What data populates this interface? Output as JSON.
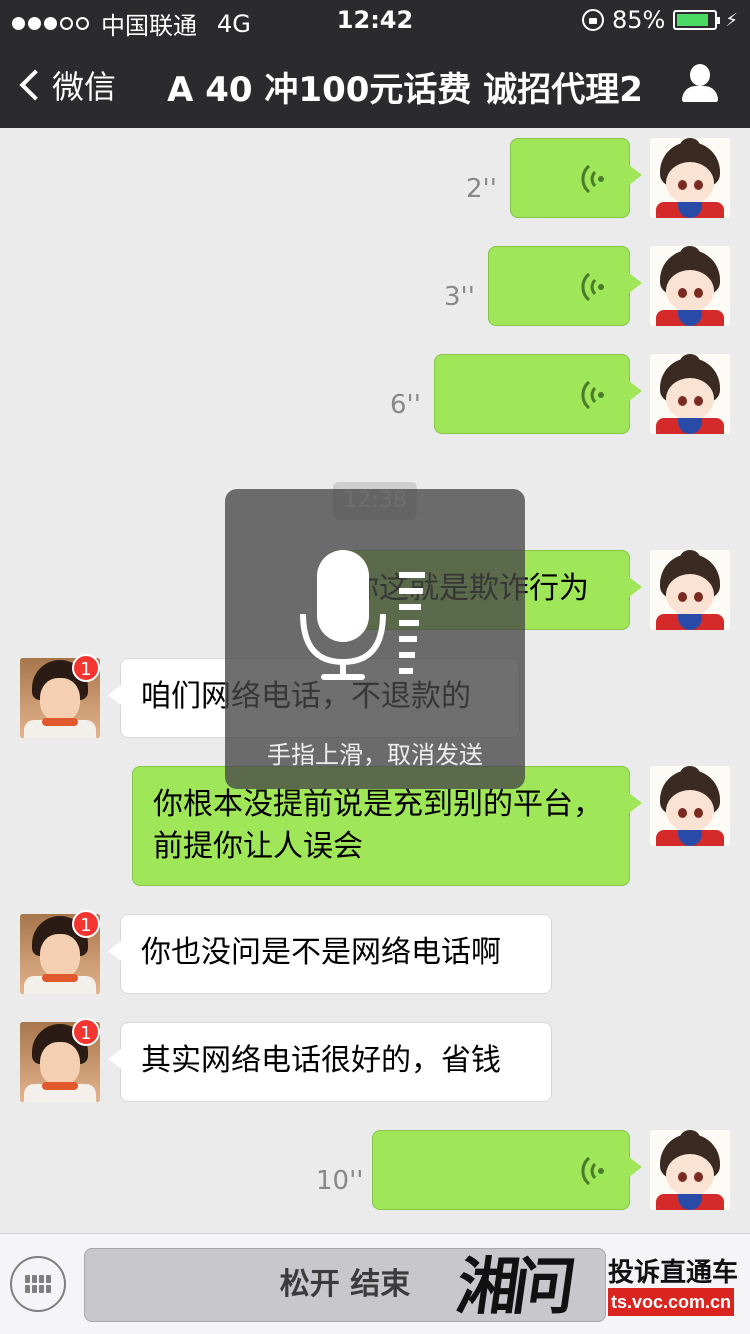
{
  "status_bar": {
    "signal": "●●●○○",
    "carrier": "中国联通",
    "network": "4G",
    "time": "12:42",
    "battery_percent": "85%",
    "battery_level": 0.85
  },
  "nav": {
    "back_label": "微信",
    "title": "A 40 冲100元话费 诚招代理2",
    "profile_icon": "person-icon"
  },
  "colors": {
    "bar_bg": "#2b2b2d",
    "chat_bg": "#ebebeb",
    "my_bubble": "#9fe658",
    "their_bubble": "#ffffff",
    "badge": "#f43530"
  },
  "messages": [
    {
      "side": "me",
      "type": "voice",
      "duration": "2''"
    },
    {
      "side": "me",
      "type": "voice",
      "duration": "3''"
    },
    {
      "side": "me",
      "type": "voice",
      "duration": "6''"
    },
    {
      "type": "time",
      "text": "12:38"
    },
    {
      "side": "me",
      "type": "text",
      "text": "你这就是欺诈行为"
    },
    {
      "side": "them",
      "type": "text",
      "text": "咱们网络电话，不退款的",
      "badge": "1"
    },
    {
      "side": "me",
      "type": "text",
      "text": "你根本没提前说是充到别的平台，前提你让人误会"
    },
    {
      "side": "them",
      "type": "text",
      "text": "你也没问是不是网络电话啊",
      "badge": "1"
    },
    {
      "side": "them",
      "type": "text",
      "text": "其实网络电话很好的，省钱",
      "badge": "1"
    },
    {
      "side": "me",
      "type": "voice",
      "duration": "10''"
    }
  ],
  "recording": {
    "hint": "手指上滑，取消发送",
    "icon": "microphone-icon"
  },
  "input_bar": {
    "toggle_icon": "keyboard-icon",
    "hold_label": "松开 结束"
  },
  "watermark": {
    "logo": "湘问",
    "slogan": "投诉直通车",
    "url": "ts.voc.com.cn"
  }
}
